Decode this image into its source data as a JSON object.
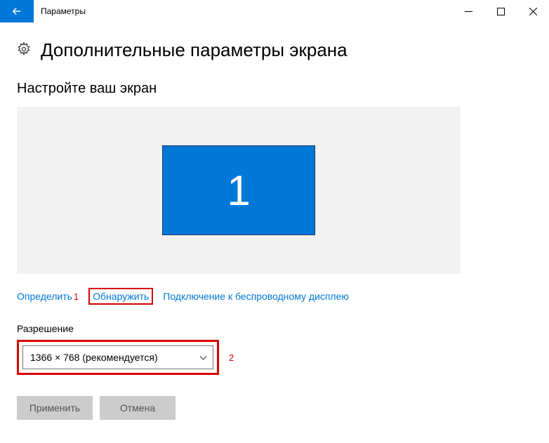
{
  "titlebar": {
    "title": "Параметры"
  },
  "header": {
    "title": "Дополнительные параметры экрана"
  },
  "section": {
    "title": "Настройте ваш экран"
  },
  "monitor": {
    "number": "1"
  },
  "links": {
    "identify": "Определить",
    "detect": "Обнаружить",
    "wireless": "Подключение к беспроводному дисплею"
  },
  "annotations": {
    "one": "1",
    "two": "2"
  },
  "resolution": {
    "label": "Разрешение",
    "selected": "1366 × 768 (рекомендуется)"
  },
  "buttons": {
    "apply": "Применить",
    "cancel": "Отмена"
  }
}
